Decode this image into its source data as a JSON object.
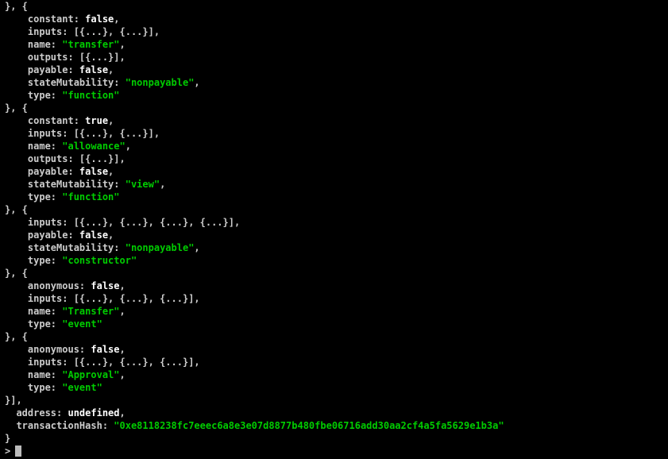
{
  "lines": {
    "l0_open": "}, {",
    "l1": "    constant: ",
    "l1v": "false",
    "l1c": ",",
    "l2": "    inputs: [{...}, {...}],",
    "l3": "    name: ",
    "l3v": "\"transfer\"",
    "l3c": ",",
    "l4": "    outputs: [{...}],",
    "l5": "    payable: ",
    "l5v": "false",
    "l5c": ",",
    "l6": "    stateMutability: ",
    "l6v": "\"nonpayable\"",
    "l6c": ",",
    "l7": "    type: ",
    "l7v": "\"function\"",
    "l8_open": "}, {",
    "l9": "    constant: ",
    "l9v": "true",
    "l9c": ",",
    "l10": "    inputs: [{...}, {...}],",
    "l11": "    name: ",
    "l11v": "\"allowance\"",
    "l11c": ",",
    "l12": "    outputs: [{...}],",
    "l13": "    payable: ",
    "l13v": "false",
    "l13c": ",",
    "l14": "    stateMutability: ",
    "l14v": "\"view\"",
    "l14c": ",",
    "l15": "    type: ",
    "l15v": "\"function\"",
    "l16_open": "}, {",
    "l17": "    inputs: [{...}, {...}, {...}, {...}],",
    "l18": "    payable: ",
    "l18v": "false",
    "l18c": ",",
    "l19": "    stateMutability: ",
    "l19v": "\"nonpayable\"",
    "l19c": ",",
    "l20": "    type: ",
    "l20v": "\"constructor\"",
    "l21_open": "}, {",
    "l22": "    anonymous: ",
    "l22v": "false",
    "l22c": ",",
    "l23": "    inputs: [{...}, {...}, {...}],",
    "l24": "    name: ",
    "l24v": "\"Transfer\"",
    "l24c": ",",
    "l25": "    type: ",
    "l25v": "\"event\"",
    "l26_open": "}, {",
    "l27": "    anonymous: ",
    "l27v": "false",
    "l27c": ",",
    "l28": "    inputs: [{...}, {...}, {...}],",
    "l29": "    name: ",
    "l29v": "\"Approval\"",
    "l29c": ",",
    "l30": "    type: ",
    "l30v": "\"event\"",
    "l31_close": "}],",
    "l32": "  address: ",
    "l32v": "undefined",
    "l32c": ",",
    "l33": "  transactionHash: ",
    "l33v": "\"0xe8118238fc7eeec6a8e3e07d8877b480fbe06716add30aa2cf4a5fa5629e1b3a\"",
    "l34_close": "}",
    "prompt": "> "
  }
}
